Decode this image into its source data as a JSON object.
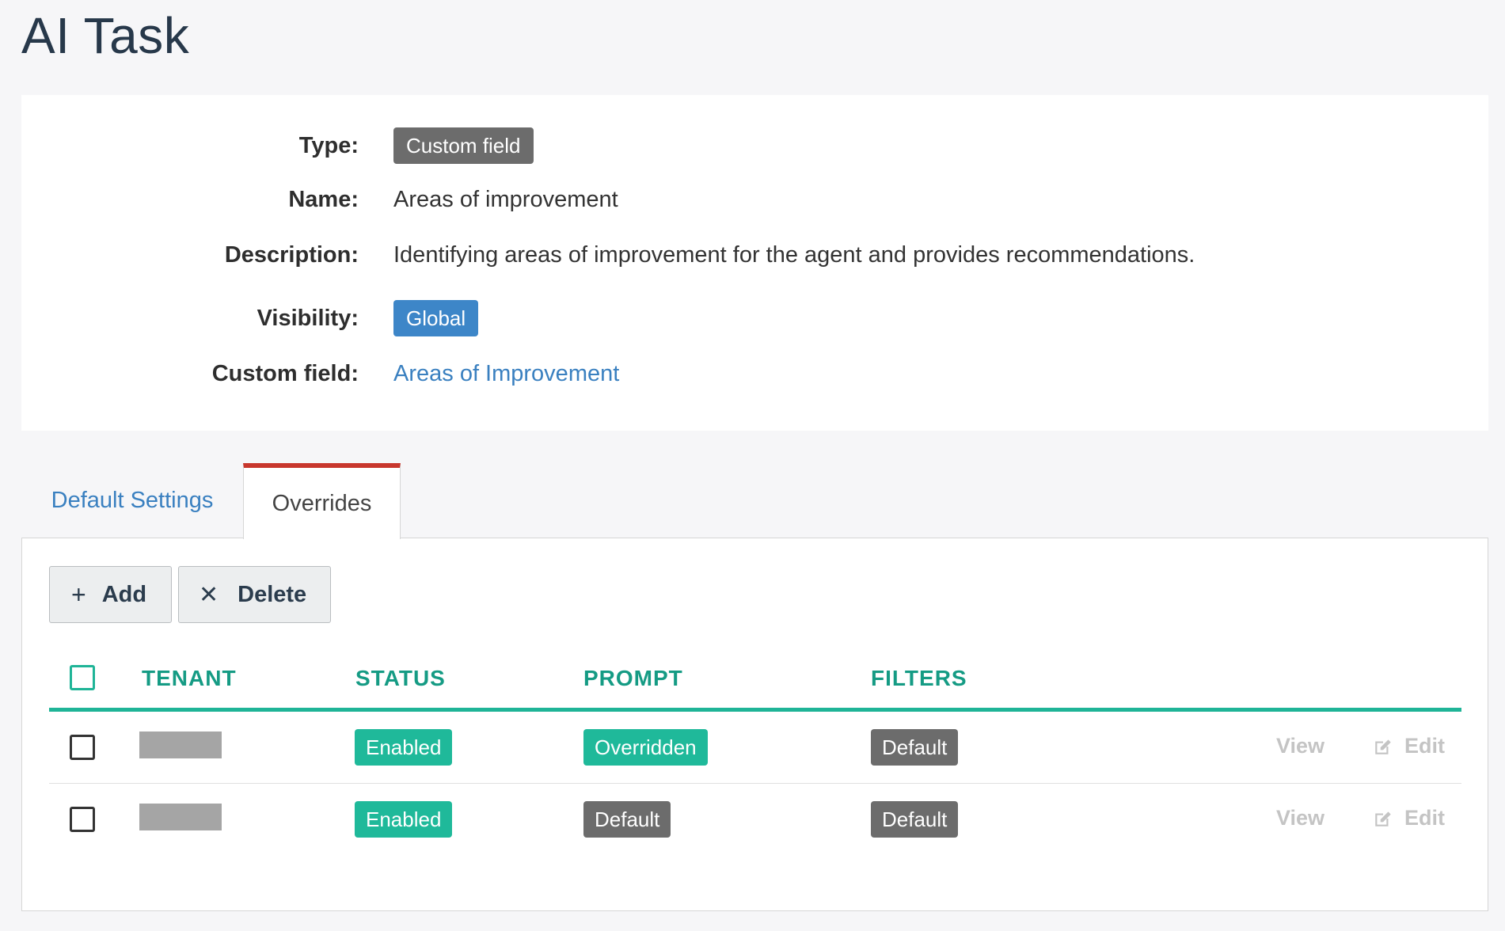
{
  "page": {
    "title": "AI Task"
  },
  "details": {
    "type": {
      "label": "Type:",
      "value": "Custom field"
    },
    "name": {
      "label": "Name:",
      "value": "Areas of improvement"
    },
    "description": {
      "label": "Description:",
      "value": "Identifying areas of improvement for the agent and provides recommendations."
    },
    "visibility": {
      "label": "Visibility:",
      "value": "Global"
    },
    "custom_field": {
      "label": "Custom field:",
      "value": "Areas of Improvement"
    }
  },
  "tabs": [
    {
      "label": "Default Settings",
      "active": false
    },
    {
      "label": "Overrides",
      "active": true
    }
  ],
  "toolbar": {
    "add_label": "Add",
    "add_icon": "plus-icon",
    "delete_label": "Delete",
    "delete_icon": "close-icon"
  },
  "table": {
    "columns": [
      "TENANT",
      "STATUS",
      "PROMPT",
      "FILTERS"
    ],
    "rows": [
      {
        "tenant": "",
        "status": "Enabled",
        "prompt": "Overridden",
        "filters": "Default",
        "view_label": "View",
        "edit_label": "Edit"
      },
      {
        "tenant": "",
        "status": "Enabled",
        "prompt": "Default",
        "filters": "Default",
        "view_label": "View",
        "edit_label": "Edit"
      }
    ]
  },
  "colors": {
    "accent_teal": "#1fb497",
    "active_tab_border": "#c8372d",
    "link_blue": "#3a80c0",
    "tag_gray": "#6c6c6c",
    "tag_blue": "#3d86c8"
  }
}
